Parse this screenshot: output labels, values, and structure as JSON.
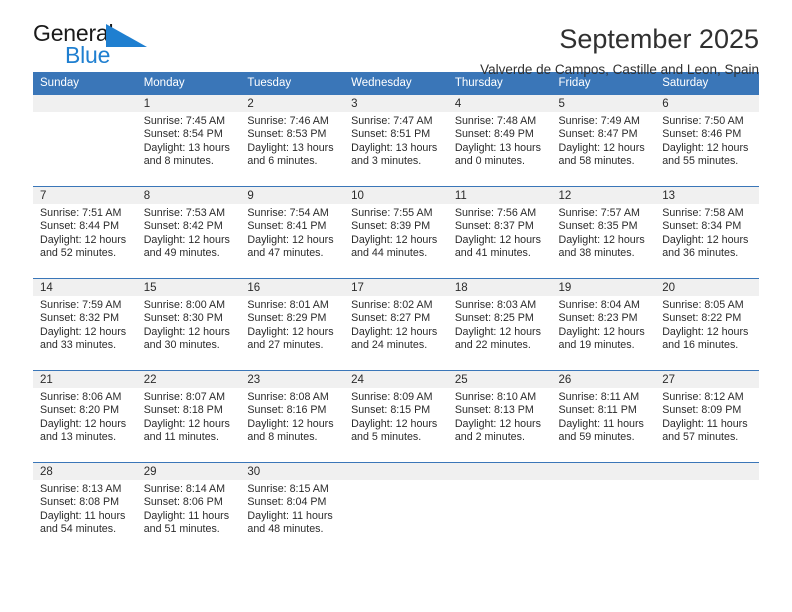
{
  "brand": {
    "name_top": "General",
    "name_bottom": "Blue",
    "triangle_color": "#1f7fd0",
    "text_color": "#1a1a1a"
  },
  "header": {
    "title": "September 2025",
    "location": "Valverde de Campos, Castille and Leon, Spain"
  },
  "theme": {
    "header_blue": "#3a76b8",
    "daynum_band": "#f0f0f0",
    "text": "#2b2b2b"
  },
  "weekdays": [
    "Sunday",
    "Monday",
    "Tuesday",
    "Wednesday",
    "Thursday",
    "Friday",
    "Saturday"
  ],
  "weeks": [
    [
      {
        "day": "",
        "sunrise": "",
        "sunset": "",
        "daylight1": "",
        "daylight2": ""
      },
      {
        "day": "1",
        "sunrise": "Sunrise: 7:45 AM",
        "sunset": "Sunset: 8:54 PM",
        "daylight1": "Daylight: 13 hours",
        "daylight2": "and 8 minutes."
      },
      {
        "day": "2",
        "sunrise": "Sunrise: 7:46 AM",
        "sunset": "Sunset: 8:53 PM",
        "daylight1": "Daylight: 13 hours",
        "daylight2": "and 6 minutes."
      },
      {
        "day": "3",
        "sunrise": "Sunrise: 7:47 AM",
        "sunset": "Sunset: 8:51 PM",
        "daylight1": "Daylight: 13 hours",
        "daylight2": "and 3 minutes."
      },
      {
        "day": "4",
        "sunrise": "Sunrise: 7:48 AM",
        "sunset": "Sunset: 8:49 PM",
        "daylight1": "Daylight: 13 hours",
        "daylight2": "and 0 minutes."
      },
      {
        "day": "5",
        "sunrise": "Sunrise: 7:49 AM",
        "sunset": "Sunset: 8:47 PM",
        "daylight1": "Daylight: 12 hours",
        "daylight2": "and 58 minutes."
      },
      {
        "day": "6",
        "sunrise": "Sunrise: 7:50 AM",
        "sunset": "Sunset: 8:46 PM",
        "daylight1": "Daylight: 12 hours",
        "daylight2": "and 55 minutes."
      }
    ],
    [
      {
        "day": "7",
        "sunrise": "Sunrise: 7:51 AM",
        "sunset": "Sunset: 8:44 PM",
        "daylight1": "Daylight: 12 hours",
        "daylight2": "and 52 minutes."
      },
      {
        "day": "8",
        "sunrise": "Sunrise: 7:53 AM",
        "sunset": "Sunset: 8:42 PM",
        "daylight1": "Daylight: 12 hours",
        "daylight2": "and 49 minutes."
      },
      {
        "day": "9",
        "sunrise": "Sunrise: 7:54 AM",
        "sunset": "Sunset: 8:41 PM",
        "daylight1": "Daylight: 12 hours",
        "daylight2": "and 47 minutes."
      },
      {
        "day": "10",
        "sunrise": "Sunrise: 7:55 AM",
        "sunset": "Sunset: 8:39 PM",
        "daylight1": "Daylight: 12 hours",
        "daylight2": "and 44 minutes."
      },
      {
        "day": "11",
        "sunrise": "Sunrise: 7:56 AM",
        "sunset": "Sunset: 8:37 PM",
        "daylight1": "Daylight: 12 hours",
        "daylight2": "and 41 minutes."
      },
      {
        "day": "12",
        "sunrise": "Sunrise: 7:57 AM",
        "sunset": "Sunset: 8:35 PM",
        "daylight1": "Daylight: 12 hours",
        "daylight2": "and 38 minutes."
      },
      {
        "day": "13",
        "sunrise": "Sunrise: 7:58 AM",
        "sunset": "Sunset: 8:34 PM",
        "daylight1": "Daylight: 12 hours",
        "daylight2": "and 36 minutes."
      }
    ],
    [
      {
        "day": "14",
        "sunrise": "Sunrise: 7:59 AM",
        "sunset": "Sunset: 8:32 PM",
        "daylight1": "Daylight: 12 hours",
        "daylight2": "and 33 minutes."
      },
      {
        "day": "15",
        "sunrise": "Sunrise: 8:00 AM",
        "sunset": "Sunset: 8:30 PM",
        "daylight1": "Daylight: 12 hours",
        "daylight2": "and 30 minutes."
      },
      {
        "day": "16",
        "sunrise": "Sunrise: 8:01 AM",
        "sunset": "Sunset: 8:29 PM",
        "daylight1": "Daylight: 12 hours",
        "daylight2": "and 27 minutes."
      },
      {
        "day": "17",
        "sunrise": "Sunrise: 8:02 AM",
        "sunset": "Sunset: 8:27 PM",
        "daylight1": "Daylight: 12 hours",
        "daylight2": "and 24 minutes."
      },
      {
        "day": "18",
        "sunrise": "Sunrise: 8:03 AM",
        "sunset": "Sunset: 8:25 PM",
        "daylight1": "Daylight: 12 hours",
        "daylight2": "and 22 minutes."
      },
      {
        "day": "19",
        "sunrise": "Sunrise: 8:04 AM",
        "sunset": "Sunset: 8:23 PM",
        "daylight1": "Daylight: 12 hours",
        "daylight2": "and 19 minutes."
      },
      {
        "day": "20",
        "sunrise": "Sunrise: 8:05 AM",
        "sunset": "Sunset: 8:22 PM",
        "daylight1": "Daylight: 12 hours",
        "daylight2": "and 16 minutes."
      }
    ],
    [
      {
        "day": "21",
        "sunrise": "Sunrise: 8:06 AM",
        "sunset": "Sunset: 8:20 PM",
        "daylight1": "Daylight: 12 hours",
        "daylight2": "and 13 minutes."
      },
      {
        "day": "22",
        "sunrise": "Sunrise: 8:07 AM",
        "sunset": "Sunset: 8:18 PM",
        "daylight1": "Daylight: 12 hours",
        "daylight2": "and 11 minutes."
      },
      {
        "day": "23",
        "sunrise": "Sunrise: 8:08 AM",
        "sunset": "Sunset: 8:16 PM",
        "daylight1": "Daylight: 12 hours",
        "daylight2": "and 8 minutes."
      },
      {
        "day": "24",
        "sunrise": "Sunrise: 8:09 AM",
        "sunset": "Sunset: 8:15 PM",
        "daylight1": "Daylight: 12 hours",
        "daylight2": "and 5 minutes."
      },
      {
        "day": "25",
        "sunrise": "Sunrise: 8:10 AM",
        "sunset": "Sunset: 8:13 PM",
        "daylight1": "Daylight: 12 hours",
        "daylight2": "and 2 minutes."
      },
      {
        "day": "26",
        "sunrise": "Sunrise: 8:11 AM",
        "sunset": "Sunset: 8:11 PM",
        "daylight1": "Daylight: 11 hours",
        "daylight2": "and 59 minutes."
      },
      {
        "day": "27",
        "sunrise": "Sunrise: 8:12 AM",
        "sunset": "Sunset: 8:09 PM",
        "daylight1": "Daylight: 11 hours",
        "daylight2": "and 57 minutes."
      }
    ],
    [
      {
        "day": "28",
        "sunrise": "Sunrise: 8:13 AM",
        "sunset": "Sunset: 8:08 PM",
        "daylight1": "Daylight: 11 hours",
        "daylight2": "and 54 minutes."
      },
      {
        "day": "29",
        "sunrise": "Sunrise: 8:14 AM",
        "sunset": "Sunset: 8:06 PM",
        "daylight1": "Daylight: 11 hours",
        "daylight2": "and 51 minutes."
      },
      {
        "day": "30",
        "sunrise": "Sunrise: 8:15 AM",
        "sunset": "Sunset: 8:04 PM",
        "daylight1": "Daylight: 11 hours",
        "daylight2": "and 48 minutes."
      },
      {
        "day": "",
        "sunrise": "",
        "sunset": "",
        "daylight1": "",
        "daylight2": ""
      },
      {
        "day": "",
        "sunrise": "",
        "sunset": "",
        "daylight1": "",
        "daylight2": ""
      },
      {
        "day": "",
        "sunrise": "",
        "sunset": "",
        "daylight1": "",
        "daylight2": ""
      },
      {
        "day": "",
        "sunrise": "",
        "sunset": "",
        "daylight1": "",
        "daylight2": ""
      }
    ]
  ]
}
